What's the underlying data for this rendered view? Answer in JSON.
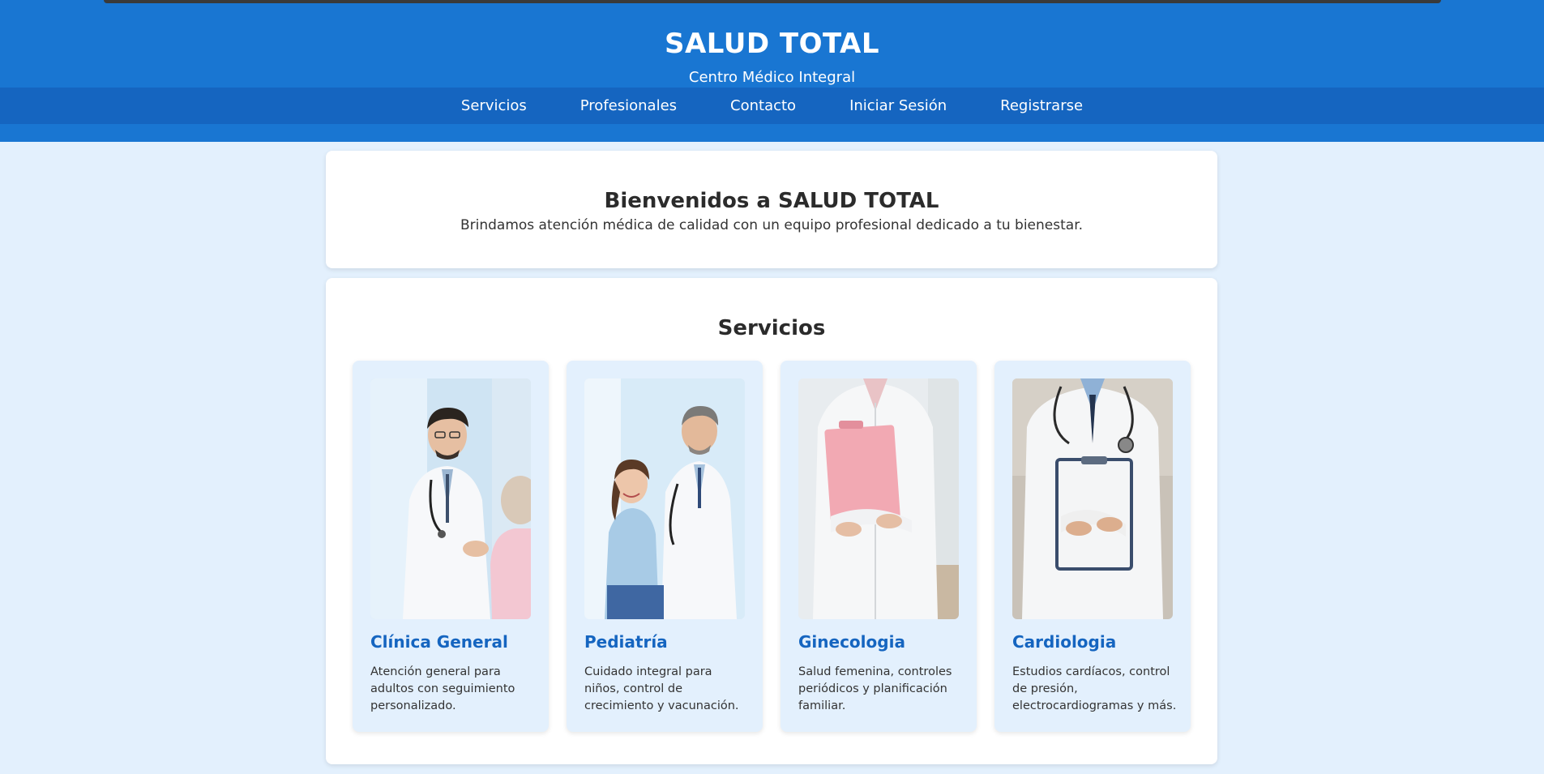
{
  "header": {
    "title": "SALUD TOTAL",
    "subtitle": "Centro Médico Integral"
  },
  "nav": {
    "items": [
      "Servicios",
      "Profesionales",
      "Contacto",
      "Iniciar Sesión",
      "Registrarse"
    ]
  },
  "welcome": {
    "title": "Bienvenidos a SALUD TOTAL",
    "text": "Brindamos atención médica de calidad con un equipo profesional dedicado a tu bienestar."
  },
  "services": {
    "title": "Servicios",
    "items": [
      {
        "name": "Clínica General",
        "description": "Atención general para adultos con seguimiento personalizado."
      },
      {
        "name": "Pediatría",
        "description": "Cuidado integral para niños, control de crecimiento y vacunación."
      },
      {
        "name": "Ginecologia",
        "description": "Salud femenina, controles periódicos y planificación familiar."
      },
      {
        "name": "Cardiologia",
        "description": "Estudios cardíacos, control de presión, electrocardiogramas y más."
      }
    ]
  },
  "colors": {
    "header": "#1976d2",
    "nav": "#1565c0",
    "background": "#e3f0fd",
    "accent": "#1565c0"
  }
}
